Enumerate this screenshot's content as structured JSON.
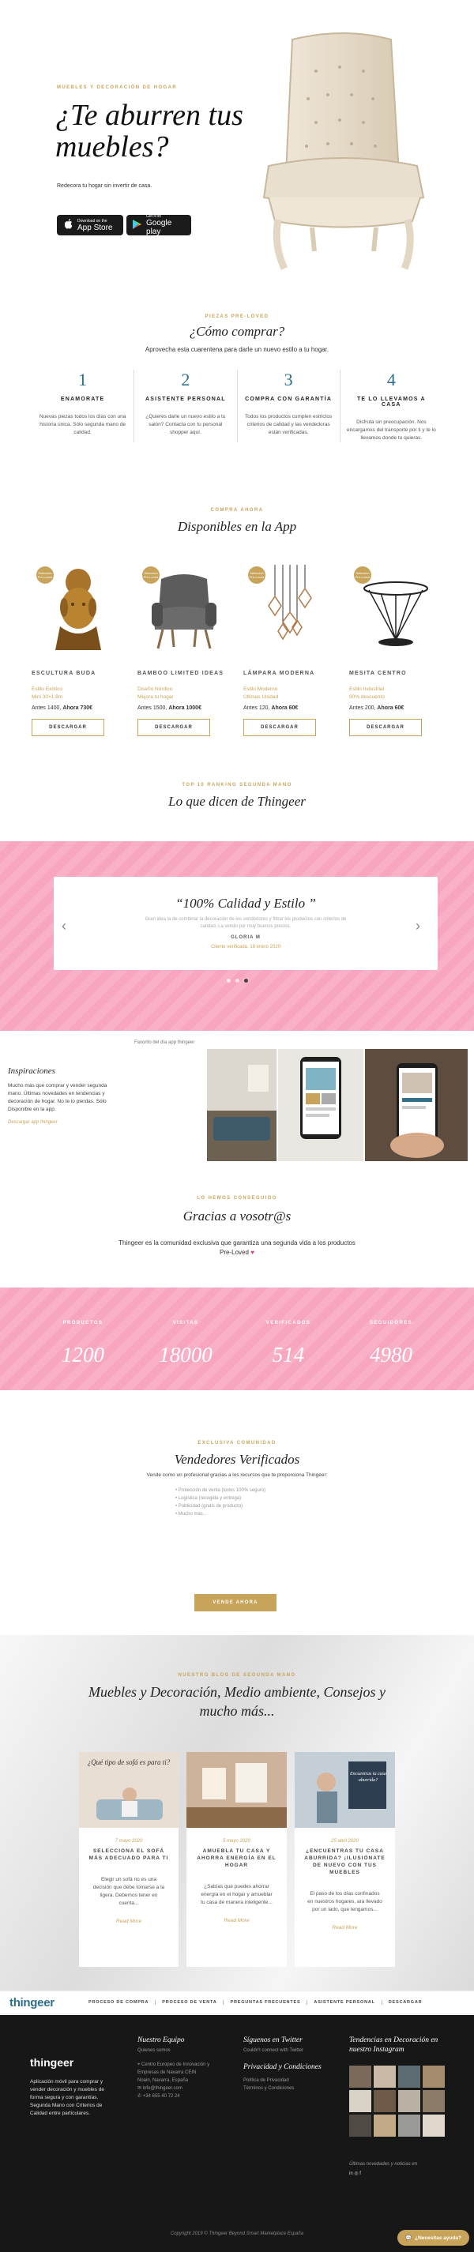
{
  "hero": {
    "eyebrow": "Muebles y decoración de hogar",
    "title": "¿Te aburren tus muebles?",
    "subtitle": "Redecora tu hogar sin invertir de casa.",
    "app_store": {
      "small": "Download on the",
      "big": "App Store"
    },
    "google_play": {
      "small": "Get it on",
      "big": "Google play"
    }
  },
  "how": {
    "eyebrow": "Piezas pre-loved",
    "title": "¿Cómo comprar?",
    "intro": "Aprovecha esta cuarentena para darle un nuevo estilo a tu hogar.",
    "steps": [
      {
        "num": "1",
        "title": "ENAMORATE",
        "desc": "Nuevas piezas todos los días con una historia única. Sólo segunda mano de calidad."
      },
      {
        "num": "2",
        "title": "ASISTENTE PERSONAL",
        "desc": "¿Quieres darle un nuevo estilo a tu salón? Contacta con tu personal shopper aquí."
      },
      {
        "num": "3",
        "title": "COMPRA CON GARANTÍA",
        "desc": "Todos los productos cumplen estrictos criterios de calidad y las vendedoras están verificadas."
      },
      {
        "num": "4",
        "title": "TE LO LLEVAMOS A CASA",
        "desc": "Disfruta sin preocupación. Nos encargamos del transporte por ti y te lo llevamos donde tu quieras."
      }
    ]
  },
  "products": {
    "eyebrow": "Compra ahora",
    "title": "Disponibles en la App",
    "badge": "Selección Pre-Loved",
    "download_label": "DESCARGAR",
    "items": [
      {
        "name": "ESCULTURA BUDA",
        "style": "Estilo Exótico",
        "size": "Mini 30×1,8m",
        "price_before": "Antes 1400,",
        "price_now": "Ahora 730€"
      },
      {
        "name": "BAMBOO LIMITED IDEAS",
        "style": "Diseño Nórdico",
        "size": "Mejora tu hogar",
        "price_before": "Antes 1500,",
        "price_now": "Ahora 1000€"
      },
      {
        "name": "LÁMPARA MODERNA",
        "style": "Estilo Moderno",
        "size": "Últimas Unidad",
        "price_before": "Antes 120,",
        "price_now": "Ahora 60€"
      },
      {
        "name": "MESITA CENTRO",
        "style": "Estilo Industrial",
        "size": "90% descuento",
        "price_before": "Antes 200,",
        "price_now": "Ahora 60€"
      }
    ]
  },
  "testimonials": {
    "eyebrow": "Top 10 ranking segunda mano",
    "title": "Lo que dicen de Thingeer",
    "quote": "“100% Calidad y Estilo ”",
    "text": "Gran idea la de combinar la decoración de los vendedores y filtrar los productos con criterios de calidad. La vendo por muy buenos precios.",
    "author": "GLORIA M",
    "date": "Cliente verificada. 18 enero 2020"
  },
  "favorites": {
    "caption": "Favorito del día app thingeer",
    "heading": "Inspiraciones",
    "text": "Mucho más que comprar y vender segunda mano. Últimas novedades en tendencias y decoración de hogar. No te lo pierdas. Sólo Disponible en la app.",
    "link": "Descargar app thingeer"
  },
  "thanks": {
    "eyebrow": "Lo hemos conseguido",
    "title": "Gracias a vosotr@s",
    "text": "Thingeer es la comunidad exclusiva que garantiza una segunda vida a los productos Pre-Loved",
    "heart": "♥"
  },
  "stats": [
    {
      "label": "PRODUCTOS",
      "value": "1200"
    },
    {
      "label": "VISITAS",
      "value": "18000"
    },
    {
      "label": "VERIFICADOS",
      "value": "514"
    },
    {
      "label": "SEGUIDORES",
      "value": "4980"
    }
  ],
  "verified": {
    "eyebrow": "Exclusiva comunidad",
    "title": "Vendedores Verificados",
    "intro": "Vende como un profesional gracias a los recursos que te proporciona Thingeer:",
    "items": [
      "Protección de venta (todos 100% seguro)",
      "Logística (recogida y entrega)",
      "Publicidad (gratis de producto)",
      "Mucho más..."
    ],
    "button": "VENDE AHORA"
  },
  "blog": {
    "eyebrow": "Nuestro blog de segunda mano",
    "title": "Muebles y Decoración, Medio ambiente, Consejos y mucho más...",
    "read_more": "Read More",
    "posts": [
      {
        "overlay": "¿Qué tipo de sofá es para ti?",
        "date": "7 mayo 2020",
        "title": "SELECCIONA EL SOFÁ MÁS ADECUADO PARA TI",
        "excerpt": "Elegir un sofá no es una decisión que debe tomarse a la ligera. Debemos tener en cuenta..."
      },
      {
        "overlay": "",
        "date": "5 mayo 2020",
        "title": "AMUEBLA TU CASA Y AHORRA ENERGÍA EN EL HOGAR",
        "excerpt": "¿Sabías que puedes ahorrar energía en el hogar y amueblar tu casa de manera inteligente..."
      },
      {
        "overlay": "Encuentras tu casa aburrida?",
        "date": "25 abril 2020",
        "title": "¿ENCUENTRAS TU CASA ABURRIDA? ¡ILUSIÓNATE DE NUEVO CON TUS MUEBLES",
        "excerpt": "El paso de los días confinados en nuestros hogares, ara llevado por un lado, que tengamos..."
      }
    ]
  },
  "navbar": {
    "logo": "thingeer",
    "links": [
      "PROCESO DE COMPRA",
      "PROCESO DE VENTA",
      "PREGUNTAS FRECUENTES",
      "ASISTENTE PERSONAL",
      "DESCARGAR"
    ]
  },
  "footer": {
    "logo": "thingeer",
    "about": "Aplicación móvil para comprar y vender decoración y muebles de forma segura y con garantías. Segunda Mano con Criterios de Calidad entre particulares.",
    "col1": {
      "title": "Nuestro Equipo",
      "sub": "Quienes somos",
      "lines": [
        "Centro Europeo de Innovación y Empresas de Navarra CEIN",
        "Noain, Navarra, España",
        "info@thingeer.com",
        "+34 655 40 72 24"
      ]
    },
    "col2": {
      "title": "Síguenos en Twitter",
      "sub": "Couldn't connect with Twitter",
      "title2": "Privacidad y Condiciones",
      "lines": [
        "Política de Privacidad",
        "Términos y Condiciones"
      ]
    },
    "col3": {
      "title": "Tendencias en Decoración en nuestro Instagram",
      "sub": "Últimas novedades y noticias en",
      "social": "in  ◎  f"
    },
    "copyright": "Copyright 2019 © Thingeer Beyond Smart Marketplace España",
    "help": "¿Necesitas ayuda?"
  },
  "colors": {
    "gold": "#c8a45a",
    "pink": "#f8a5bf",
    "teal": "#2f6f8a",
    "dark": "#171717"
  }
}
